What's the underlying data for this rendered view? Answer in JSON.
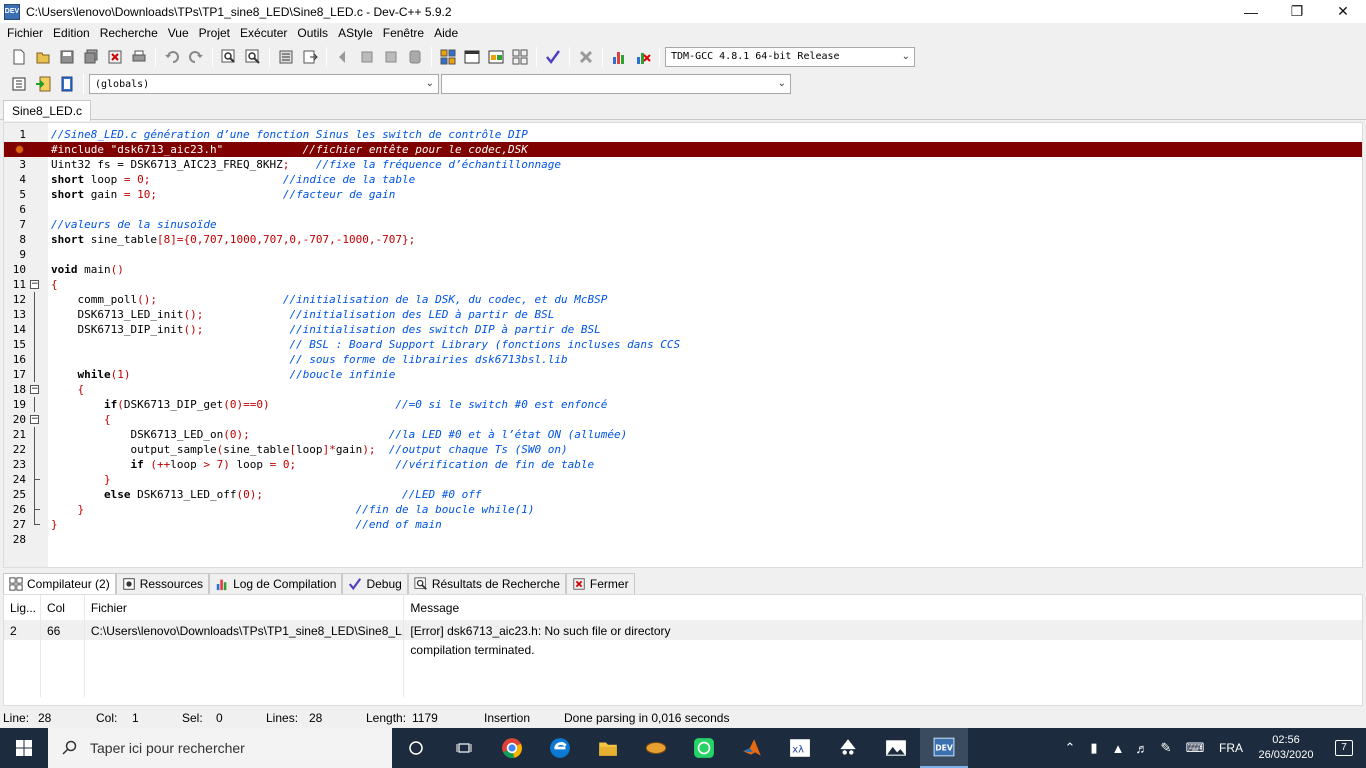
{
  "window": {
    "title": "C:\\Users\\lenovo\\Downloads\\TPs\\TP1_sine8_LED\\Sine8_LED.c - Dev-C++ 5.9.2",
    "app_icon": "DEV"
  },
  "menu": [
    "Fichier",
    "Edition",
    "Recherche",
    "Vue",
    "Projet",
    "Exécuter",
    "Outils",
    "AStyle",
    "Fenêtre",
    "Aide"
  ],
  "toolbar": {
    "compiler": "TDM-GCC 4.8.1 64-bit Release",
    "scope": "(globals)",
    "member": ""
  },
  "file_tab": "Sine8_LED.c",
  "code_lines": [
    {
      "n": "1"
    },
    {
      "n": "2"
    },
    {
      "n": "3"
    },
    {
      "n": "4"
    },
    {
      "n": "5"
    },
    {
      "n": "6"
    },
    {
      "n": "7"
    },
    {
      "n": "8"
    },
    {
      "n": "9"
    },
    {
      "n": "10"
    },
    {
      "n": "11"
    },
    {
      "n": "12"
    },
    {
      "n": "13"
    },
    {
      "n": "14"
    },
    {
      "n": "15"
    },
    {
      "n": "16"
    },
    {
      "n": "17"
    },
    {
      "n": "18"
    },
    {
      "n": "19"
    },
    {
      "n": "20"
    },
    {
      "n": "21"
    },
    {
      "n": "22"
    },
    {
      "n": "23"
    },
    {
      "n": "24"
    },
    {
      "n": "25"
    },
    {
      "n": "26"
    },
    {
      "n": "27"
    },
    {
      "n": "28"
    }
  ],
  "code": {
    "l1": "//Sine8_LED.c génération d’une fonction Sinus les switch de contrôle DIP",
    "l2a": "#include \"dsk6713_aic23.h\"",
    "l2b": "//fichier entête pour le codec,DSK",
    "l3a": "Uint32 fs = DSK6713_AIC23_FREQ_8KHZ",
    "l3b": ";",
    "l3c": "//fixe la fréquence d’échantillonnage",
    "l4a": "short",
    "l4b": " loop ",
    "l4c": "= 0;",
    "l4d": "//indice de la table",
    "l5a": "short",
    "l5b": " gain ",
    "l5c": "= 10;",
    "l5d": "//facteur de gain",
    "l7": "//valeurs de la sinusoïde",
    "l8a": "short",
    "l8b": " sine_table",
    "l8c": "[8]={0,707,1000,707,0,-707,-1000,-707};",
    "l10a": "void",
    "l10b": " main",
    "l10c": "()",
    "l11": "{",
    "l12a": "comm_poll",
    "l12b": "();",
    "l12c": "//initialisation de la DSK, du codec, et du McBSP",
    "l13a": "DSK6713_LED_init",
    "l13b": "();",
    "l13c": "//initialisation des LED à partir de BSL",
    "l14a": "DSK6713_DIP_init",
    "l14b": "();",
    "l14c": "//initialisation des switch DIP à partir de BSL",
    "l15": "// BSL : Board Support Library (fonctions incluses dans CCS",
    "l16": "// sous forme de librairies dsk6713bsl.lib",
    "l17a": "while",
    "l17b": "(1)",
    "l17c": "//boucle infinie",
    "l18": "{",
    "l19a": "if",
    "l19b": "(",
    "l19c": "DSK6713_DIP_get",
    "l19d": "(0)==0)",
    "l19e": "//=0 si le switch #0 est enfoncé",
    "l20": "{",
    "l21a": "DSK6713_LED_on",
    "l21b": "(0);",
    "l21c": "//la LED #0 et à l’état ON (allumée)",
    "l22a": "output_sample",
    "l22b": "(",
    "l22c": "sine_table",
    "l22d": "[",
    "l22e": "loop",
    "l22f": "]*",
    "l22g": "gain",
    "l22h": ");",
    "l22i": "//output chaque Ts (SW0 on)",
    "l23a": "if",
    "l23b": " (++",
    "l23c": "loop",
    "l23d": " > 7) ",
    "l23e": "loop",
    "l23f": " = 0;",
    "l23g": "//vérification de fin de table",
    "l24": "}",
    "l25a": "else",
    "l25b": " DSK6713_LED_off",
    "l25c": "(0);",
    "l25d": "//LED #0 off",
    "l26a": "}",
    "l26b": "//fin de la boucle while(1)",
    "l27a": "}",
    "l27b": "//end of main"
  },
  "bottom_tabs": [
    "Compilateur (2)",
    "Ressources",
    "Log de Compilation",
    "Debug",
    "Résultats de Recherche",
    "Fermer"
  ],
  "messages": {
    "headers": [
      "Lig...",
      "Col",
      "Fichier",
      "Message"
    ],
    "rows": [
      {
        "line": "2",
        "col": "66",
        "file": "C:\\Users\\lenovo\\Downloads\\TPs\\TP1_sine8_LED\\Sine8_L...",
        "msg": "[Error] dsk6713_aic23.h: No such file or directory"
      },
      {
        "line": "",
        "col": "",
        "file": "",
        "msg": "compilation terminated."
      }
    ]
  },
  "status": {
    "line_label": "Line:",
    "line": "28",
    "col_label": "Col:",
    "col": "1",
    "sel_label": "Sel:",
    "sel": "0",
    "lines_label": "Lines:",
    "lines": "28",
    "length_label": "Length:",
    "length": "1179",
    "mode": "Insertion",
    "message": "Done parsing in 0,016 seconds"
  },
  "taskbar": {
    "search_placeholder": "Taper ici pour rechercher",
    "lang": "FRA",
    "time": "02:56",
    "date": "26/03/2020",
    "notifications": "7"
  },
  "colors": {
    "error_line": "#800000",
    "comment": "#0054e3",
    "number": "#c00000",
    "taskbar": "#1c2b3d"
  }
}
